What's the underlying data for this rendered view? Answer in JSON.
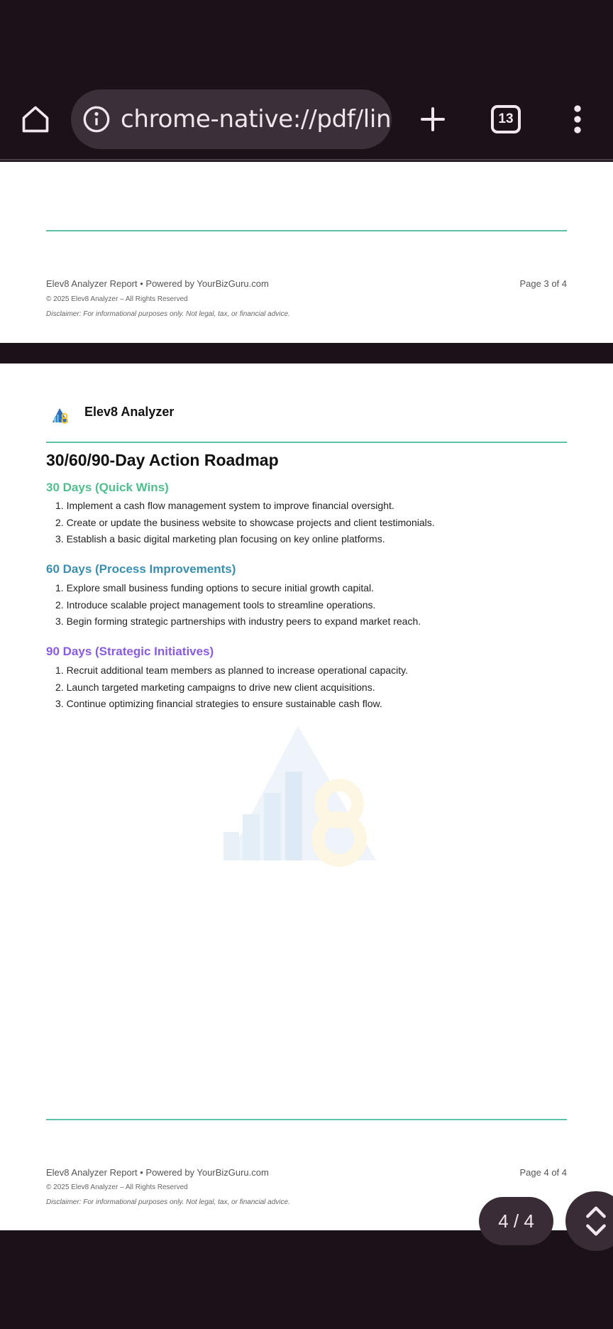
{
  "browser": {
    "url": "chrome-native://pdf/link",
    "tab_count": "13"
  },
  "page3": {
    "footer_left": "Elev8 Analyzer Report • Powered by YourBizGuru.com",
    "copyright": "© 2025 Elev8 Analyzer – All Rights Reserved",
    "disclaimer": "Disclaimer: For informational purposes only. Not legal, tax, or financial advice.",
    "page_label": "Page 3 of 4"
  },
  "page4": {
    "brand": "Elev8 Analyzer",
    "title": "30/60/90-Day Action Roadmap",
    "sections": [
      {
        "heading": "30 Days (Quick Wins)",
        "items": [
          "1. Implement a cash flow management system to improve financial oversight.",
          "2. Create or update the business website to showcase projects and client testimonials.",
          "3. Establish a basic digital marketing plan focusing on key online platforms."
        ]
      },
      {
        "heading": "60 Days (Process Improvements)",
        "items": [
          "1. Explore small business funding options to secure initial growth capital.",
          "2. Introduce scalable project management tools to streamline operations.",
          "3. Begin forming strategic partnerships with industry peers to expand market reach."
        ]
      },
      {
        "heading": "90 Days (Strategic Initiatives)",
        "items": [
          "1. Recruit additional team members as planned to increase operational capacity.",
          "2. Launch targeted marketing campaigns to drive new client acquisitions.",
          "3. Continue optimizing financial strategies to ensure sustainable cash flow."
        ]
      }
    ],
    "footer_left": "Elev8 Analyzer Report • Powered by YourBizGuru.com",
    "copyright": "© 2025 Elev8 Analyzer – All Rights Reserved",
    "disclaimer": "Disclaimer: For informational purposes only. Not legal, tax, or financial advice.",
    "page_label": "Page 4 of 4"
  },
  "viewer": {
    "page_indicator": "4 / 4"
  },
  "colors": {
    "accent_rule": "#5ec3a6",
    "heading_30": "#4fbf8e",
    "heading_60": "#3a8fb1",
    "heading_90": "#8a5be2"
  }
}
